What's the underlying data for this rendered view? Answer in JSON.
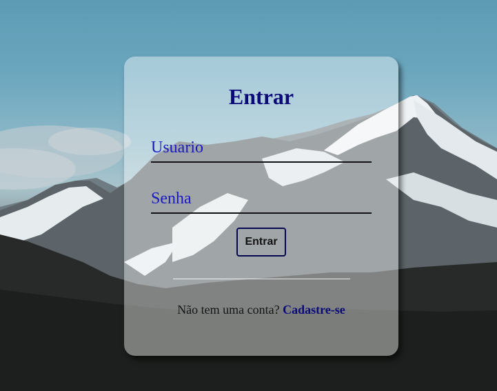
{
  "login": {
    "title": "Entrar",
    "username_placeholder": "Usuario",
    "password_placeholder": "Senha",
    "submit_label": "Entrar",
    "signup_prompt": "Não tem uma conta?",
    "signup_link": "Cadastre-se"
  },
  "colors": {
    "title": "#0a0a78",
    "placeholder": "#1a1ac4",
    "link": "#0a0a78",
    "button_border": "#06064f"
  }
}
